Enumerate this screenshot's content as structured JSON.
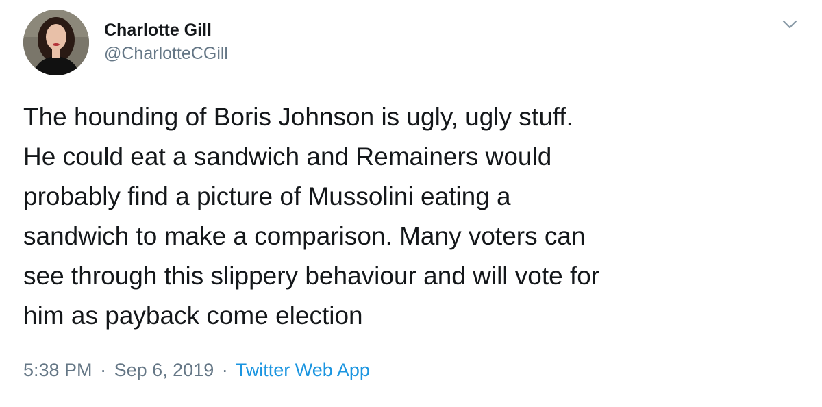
{
  "author": {
    "display_name": "Charlotte Gill",
    "handle": "@CharlotteCGill"
  },
  "tweet": {
    "text": "The hounding of Boris Johnson is ugly, ugly stuff.\nHe could eat a sandwich and Remainers would\nprobably find a picture of Mussolini eating a\nsandwich to make a comparison. Many voters can\nsee through this slippery behaviour and will vote for\nhim as payback come election",
    "time": "5:38 PM",
    "separator": "·",
    "date": "Sep 6, 2019",
    "source": "Twitter Web App"
  },
  "icons": {
    "menu": "chevron-down-icon"
  },
  "colors": {
    "text": "#14171a",
    "secondary": "#657786",
    "link": "#1b95e0"
  }
}
